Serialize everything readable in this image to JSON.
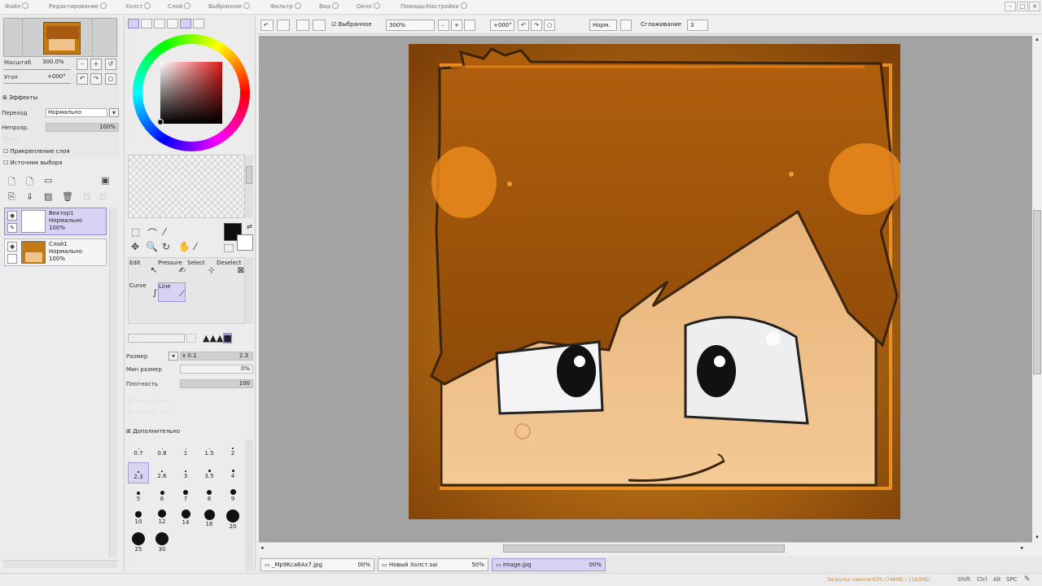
{
  "menubar": {
    "items": [
      "Файл",
      "Редактирование",
      "Холст",
      "Слой",
      "Выбранное",
      "Фильтр",
      "Вид",
      "Окно",
      "Помощь/Настройки"
    ],
    "window_buttons": [
      "–",
      "□",
      "×"
    ]
  },
  "navigator": {
    "zoom_label": "Масштаб",
    "zoom_value": "300.0%",
    "angle_label": "Угол",
    "angle_value": "+000°"
  },
  "effects": {
    "header": "Эффекты",
    "blend_label": "Переход",
    "blend_value": "Нормально",
    "opacity_label": "Непрозр.",
    "opacity_value": "100%",
    "clip_label": "Прикрепление слоя",
    "source_label": "Источник выбора"
  },
  "layers": [
    {
      "name": "Вектор1",
      "mode": "Нормально",
      "opacity": "100%",
      "selected": true
    },
    {
      "name": "Слой1",
      "mode": "Нормально",
      "opacity": "100%",
      "selected": false
    }
  ],
  "tools": {
    "row1": [
      "Edit",
      "Pressure",
      "Select",
      "Deselect"
    ],
    "row2": [
      "Curve",
      "Line"
    ],
    "size_label": "Размер",
    "size_mult": "x 0.1",
    "size_value": "2.3",
    "minsize_label": "Мин размер",
    "minsize_value": "0%",
    "density_label": "Плотность",
    "density_value": "100",
    "advanced_label": "Дополнительно",
    "brush_sizes": [
      "0.7",
      "0.8",
      "1",
      "1.5",
      "2",
      "2.3",
      "2.6",
      "3",
      "3.5",
      "4",
      "5",
      "6",
      "7",
      "8",
      "9",
      "10",
      "12",
      "14",
      "16",
      "20",
      "25",
      "30"
    ],
    "selected_brush": "2.3"
  },
  "toolbar": {
    "selection_label": "Выбранное",
    "zoom_value": "300%",
    "angle_value": "+000°",
    "mode_value": "Норм.",
    "stabilizer_label": "Сглаживание",
    "stabilizer_value": "3"
  },
  "tabs": [
    {
      "name": "_Mp9Kca6Ax7.jpg",
      "zoom": "00%"
    },
    {
      "name": "Новый Холст.sai",
      "zoom": "50%"
    },
    {
      "name": "image.jpg",
      "zoom": "00%"
    }
  ],
  "status": {
    "memory_text": "Загрузка памяти:63% (746МБ / 1183МБ)",
    "keys": [
      "Shift",
      "Ctrl",
      "Alt",
      "SPC"
    ]
  },
  "colors": {
    "accent": "#d6d3f4",
    "hair": "#b8660f",
    "skin": "#f2c48d",
    "background": "#c27a14",
    "current_color": "#111111"
  }
}
